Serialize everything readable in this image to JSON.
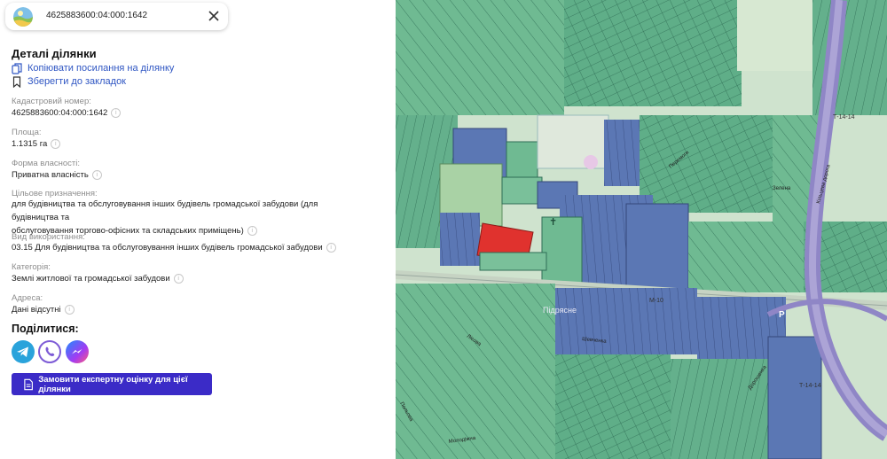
{
  "search": {
    "value": "4625883600:04:000:1642"
  },
  "details": {
    "title": "Деталі ділянки",
    "copy_link": "Копіювати посилання на ділянку",
    "bookmark": "Зберегти до закладок"
  },
  "fields": {
    "cadastral": {
      "label": "Кадастровий номер:",
      "value": "4625883600:04:000:1642"
    },
    "area": {
      "label": "Площа:",
      "value": "1.1315 га"
    },
    "ownership": {
      "label": "Форма власності:",
      "value": "Приватна власність"
    },
    "purpose": {
      "label": "Цільове призначення:",
      "line1": "для будівництва та обслуговування інших будівель громадської забудови (для будівництва та",
      "line2": "обслуговування торгово-офісних та складських приміщень)"
    },
    "usage": {
      "label": "Вид використання:",
      "value": "03.15 Для будівництва та обслуговування інших будівель громадської забудови"
    },
    "category": {
      "label": "Категорія:",
      "value": "Землі житлової та громадської забудови"
    },
    "address": {
      "label": "Адреса:",
      "value": "Дані відсутні"
    }
  },
  "share": {
    "title": "Поділитися:",
    "icons": [
      "telegram-icon",
      "viber-icon",
      "messenger-icon"
    ]
  },
  "cta": {
    "label": "Замовити експертну оцінку для цієї ділянки"
  },
  "map": {
    "labels": {
      "road1": "Т-14-14",
      "road2": "Т-14-14",
      "road3": "М-10",
      "district": "Підрясне",
      "parking": "P",
      "street1": "Шевченка",
      "street2": "Кільцева дорога",
      "street3": "Зелена",
      "street4": "Лісова",
      "street5": "Молодіжна",
      "street6": "Дорошенка",
      "street7": "Польова",
      "street8": "Перемоги"
    }
  },
  "colors": {
    "accent": "#3b2bc7",
    "link": "#2f56c3",
    "parcel_selected": "#e0322e",
    "parcel_green": "#5fb08a",
    "parcel_blue": "#5b77b4"
  }
}
